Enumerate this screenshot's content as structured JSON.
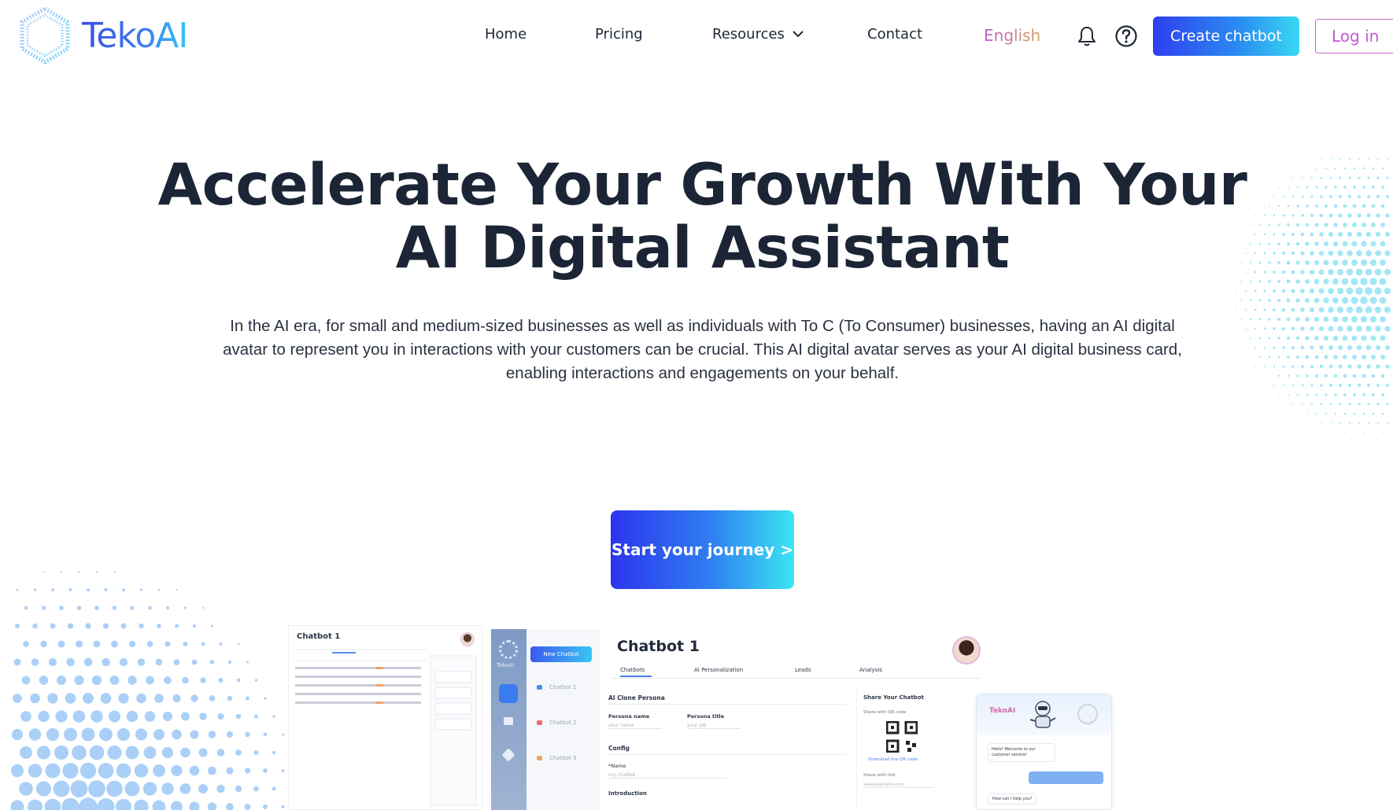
{
  "brand": {
    "name": "TekoAI"
  },
  "nav": {
    "home": "Home",
    "pricing": "Pricing",
    "resources": "Resources",
    "contact": "Contact",
    "language": "English"
  },
  "header": {
    "create_button": "Create chatbot",
    "login_button": "Log in"
  },
  "hero": {
    "title_line1": "Accelerate Your Growth With Your",
    "title_line2": "AI Digital Assistant",
    "description": "In the AI era, for small and medium-sized businesses as well as individuals with To C (To Consumer) businesses, having an AI digital avatar to represent you in interactions with your customers can be crucial. This AI digital avatar serves as your AI digital business card, enabling interactions and engagements on your behalf.",
    "cta": "Start your journey >"
  },
  "preview": {
    "table_title": "Chatbot 1",
    "sidebar_brand": "TekoAI",
    "new_chatbot": "New Chatbot",
    "chatbots": [
      "Chatbot 1",
      "Chatbot 2",
      "Chatbot 3"
    ],
    "main_title": "Chatbot 1",
    "tabs": [
      "Chatbots",
      "AI Personalization",
      "Leads",
      "Analysis"
    ],
    "section_persona": "AI Clone Persona",
    "persona_name_label": "Persona name",
    "persona_name_placeholder": "your name",
    "persona_title_label": "Persona title",
    "persona_title_placeholder": "your job",
    "section_config": "Config",
    "config_name_label": "*Name",
    "config_name_value": "my chatbot",
    "section_intro": "Introduction",
    "share_title": "Share Your Chatbot",
    "share_qr": "Share with QR code",
    "download_qr": "Download the QR code",
    "share_link": "Share with link",
    "share_link_value": "www.example.com",
    "chat_brand": "TekoAI",
    "chat_greeting": "Hello! Welcome to our customer service!",
    "chat_question": "How can I help you?"
  },
  "colors": {
    "brand_blue": "#2f3ff0",
    "brand_cyan": "#39d8f3",
    "login_purple": "#c05bd0",
    "text_dark": "#1c2535"
  }
}
